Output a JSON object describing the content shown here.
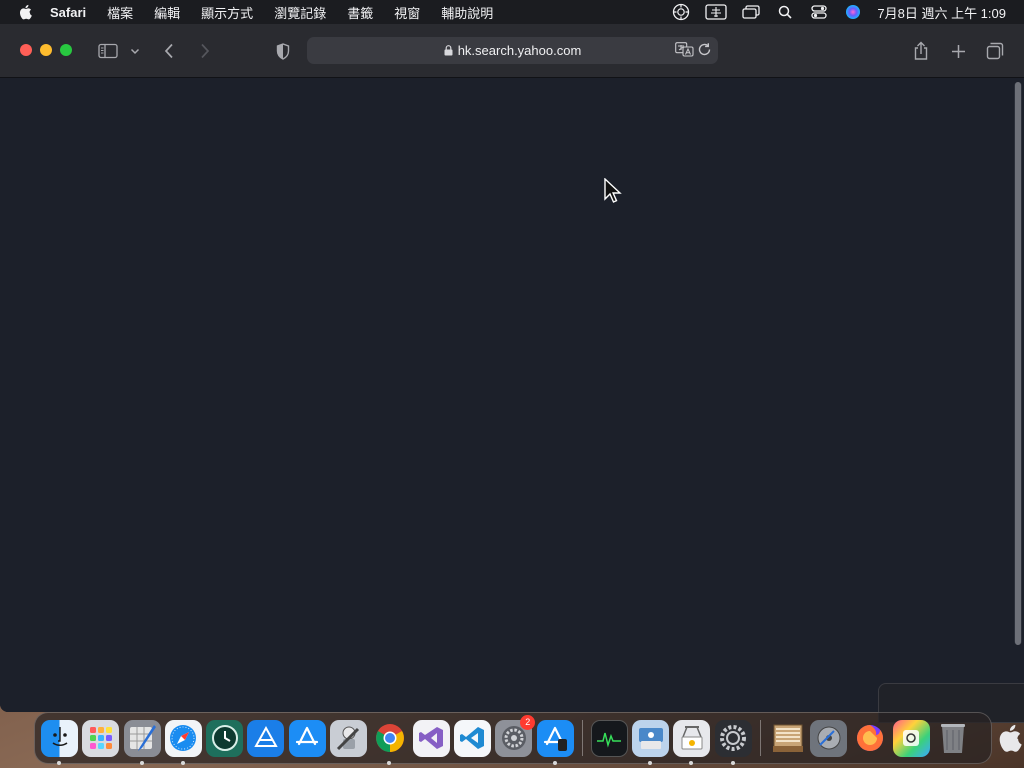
{
  "menubar": {
    "app_name": "Safari",
    "items": [
      "檔案",
      "編輯",
      "顯示方式",
      "瀏覽記錄",
      "書籤",
      "視窗",
      "輔助說明"
    ],
    "clock": "7月8日 週六 上午 1:09"
  },
  "browser": {
    "url": "hk.search.yahoo.com"
  },
  "dock": {
    "items": [
      "Finder",
      "Launchpad",
      "Script Editor",
      "Safari",
      "Time Machine",
      "Xcode",
      "App Store",
      "Automator",
      "Google Chrome",
      "Visual Studio",
      "Visual Studio Code",
      "System Preferences",
      "Simulator",
      "Activity Monitor",
      "Image Capture",
      "Preview",
      "Settings",
      "Archive",
      "Disk Utility",
      "Firefox",
      "Icon Composer",
      "Trash"
    ],
    "system_preferences_badge": "2"
  },
  "colors": {
    "menubar_bg": "#1b1c20",
    "toolbar_bg": "#2a2b30",
    "content_bg": "#1c202a",
    "close": "#ff5f57",
    "minimize": "#febc2e",
    "maximize": "#28c840"
  }
}
